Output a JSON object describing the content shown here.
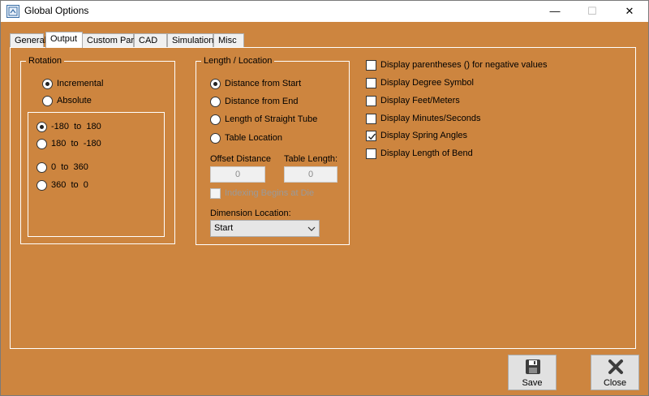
{
  "window": {
    "title": "Global Options",
    "controls": {
      "minimize": "—",
      "maximize": "☐",
      "close": "✕"
    }
  },
  "tabs": [
    {
      "label": "General"
    },
    {
      "label": "Output",
      "active": true
    },
    {
      "label": "Custom Part"
    },
    {
      "label": "CAD"
    },
    {
      "label": "Simulation"
    },
    {
      "label": "Misc"
    }
  ],
  "rotation": {
    "label": "Rotation",
    "modes": [
      {
        "label": "Incremental",
        "selected": true
      },
      {
        "label": "Absolute",
        "selected": false
      }
    ],
    "ranges": [
      {
        "label": "-180  to  180",
        "selected": true
      },
      {
        "label": "180  to  -180",
        "selected": false
      },
      {
        "label": "0  to  360",
        "selected": false
      },
      {
        "label": "360  to  0",
        "selected": false
      }
    ]
  },
  "length_location": {
    "label": "Length / Location",
    "options": [
      {
        "label": "Distance from Start",
        "selected": true
      },
      {
        "label": "Distance from End",
        "selected": false
      },
      {
        "label": "Length of Straight Tube",
        "selected": false
      },
      {
        "label": "Table Location",
        "selected": false
      }
    ],
    "offset_distance": {
      "label": "Offset Distance",
      "value": "0"
    },
    "table_length": {
      "label": "Table Length:",
      "value": "0"
    },
    "indexing": {
      "label": "Indexing Begins at Die",
      "checked": false,
      "enabled": false
    },
    "dimension_location": {
      "label": "Dimension Location:",
      "value": "Start"
    }
  },
  "display_options": [
    {
      "label": "Display parentheses () for negative values",
      "checked": false
    },
    {
      "label": "Display Degree Symbol",
      "checked": false
    },
    {
      "label": "Display Feet/Meters",
      "checked": false
    },
    {
      "label": "Display Minutes/Seconds",
      "checked": false
    },
    {
      "label": "Display Spring Angles",
      "checked": true
    },
    {
      "label": "Display Length of Bend",
      "checked": false
    }
  ],
  "buttons": {
    "save": "Save",
    "close": "Close"
  },
  "colors": {
    "background": "#cd853f",
    "border": "#ffffff"
  }
}
